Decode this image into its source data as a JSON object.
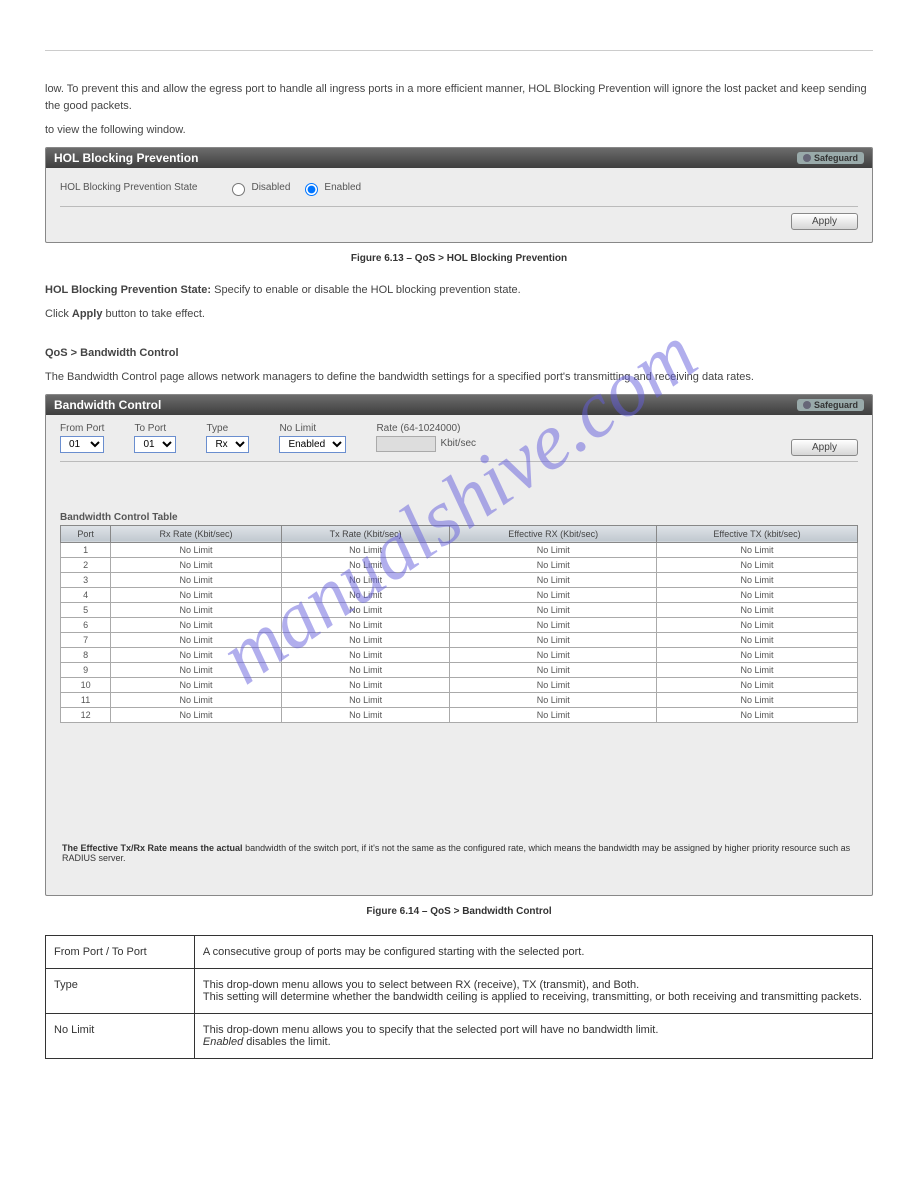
{
  "intro_text": "low. To prevent this and allow the egress port to handle all ingress ports in a more efficient manner, HOL Blocking Prevention will ignore the lost packet and keep sending the good packets.",
  "intro_note": "to view the following window.",
  "hol": {
    "title": "HOL Blocking Prevention",
    "safeguard": "Safeguard",
    "state_label": "HOL Blocking Prevention State",
    "disabled": "Disabled",
    "enabled": "Enabled",
    "apply": "Apply"
  },
  "fig1": "Figure 6.13 – QoS > HOL Blocking Prevention",
  "hol_desc_line1_bold": "HOL Blocking Prevention State:",
  "hol_desc_line1_rest": " Specify to enable or disable the HOL blocking prevention state.",
  "hol_desc_line2": " button to take effect.",
  "hol_click": "Click ",
  "hol_apply_word": "Apply",
  "bw_section_title": "QoS > Bandwidth Control",
  "bw_intro": "The Bandwidth Control page allows network managers to define the bandwidth settings for a specified port's transmitting and receiving data rates.",
  "bw": {
    "title": "Bandwidth Control",
    "safeguard": "Safeguard",
    "from_port": "From Port",
    "to_port": "To Port",
    "type": "Type",
    "no_limit": "No Limit",
    "rate_label": "Rate (64-1024000)",
    "kbitsec": "Kbit/sec",
    "from_val": "01",
    "to_val": "01",
    "type_val": "Rx",
    "nolimit_val": "Enabled",
    "apply": "Apply",
    "table_label": "Bandwidth Control Table",
    "headers": [
      "Port",
      "Rx Rate (Kbit/sec)",
      "Tx Rate (Kbit/sec)",
      "Effective RX (Kbit/sec)",
      "Effective TX (kbit/sec)"
    ],
    "rows": [
      {
        "port": "1",
        "rx": "No Limit",
        "tx": "No Limit",
        "erx": "No Limit",
        "etx": "No Limit"
      },
      {
        "port": "2",
        "rx": "No Limit",
        "tx": "No Limit",
        "erx": "No Limit",
        "etx": "No Limit"
      },
      {
        "port": "3",
        "rx": "No Limit",
        "tx": "No Limit",
        "erx": "No Limit",
        "etx": "No Limit"
      },
      {
        "port": "4",
        "rx": "No Limit",
        "tx": "No Limit",
        "erx": "No Limit",
        "etx": "No Limit"
      },
      {
        "port": "5",
        "rx": "No Limit",
        "tx": "No Limit",
        "erx": "No Limit",
        "etx": "No Limit"
      },
      {
        "port": "6",
        "rx": "No Limit",
        "tx": "No Limit",
        "erx": "No Limit",
        "etx": "No Limit"
      },
      {
        "port": "7",
        "rx": "No Limit",
        "tx": "No Limit",
        "erx": "No Limit",
        "etx": "No Limit"
      },
      {
        "port": "8",
        "rx": "No Limit",
        "tx": "No Limit",
        "erx": "No Limit",
        "etx": "No Limit"
      },
      {
        "port": "9",
        "rx": "No Limit",
        "tx": "No Limit",
        "erx": "No Limit",
        "etx": "No Limit"
      },
      {
        "port": "10",
        "rx": "No Limit",
        "tx": "No Limit",
        "erx": "No Limit",
        "etx": "No Limit"
      },
      {
        "port": "11",
        "rx": "No Limit",
        "tx": "No Limit",
        "erx": "No Limit",
        "etx": "No Limit"
      },
      {
        "port": "12",
        "rx": "No Limit",
        "tx": "No Limit",
        "erx": "No Limit",
        "etx": "No Limit"
      }
    ],
    "footer_bold": "The Effective Tx/Rx Rate means the actual ",
    "footer_rest": "bandwidth of the switch port, if it's not the same as the configured rate, which means the bandwidth may be assigned by higher priority resource such as RADIUS server."
  },
  "fig2": "Figure 6.14 – QoS > Bandwidth Control",
  "params": {
    "from_to_label": "From Port / To Port",
    "from_to_desc": "A consecutive group of ports may be configured starting with the selected port.",
    "type_label": "Type",
    "type_desc1": "This drop-down menu allows you to select between RX (receive), TX (transmit), and Both.",
    "type_desc2": "This setting will determine whether the bandwidth ceiling is applied to receiving, transmitting, or both receiving and transmitting packets.",
    "nolimit_label": "No Limit",
    "nolimit_desc1": "This drop-down menu allows you to specify that the selected port will have no bandwidth limit.",
    "nolimit_desc2_em": "Enabled",
    "nolimit_desc2_rest": " disables the limit."
  },
  "watermark": "manualshive.com"
}
